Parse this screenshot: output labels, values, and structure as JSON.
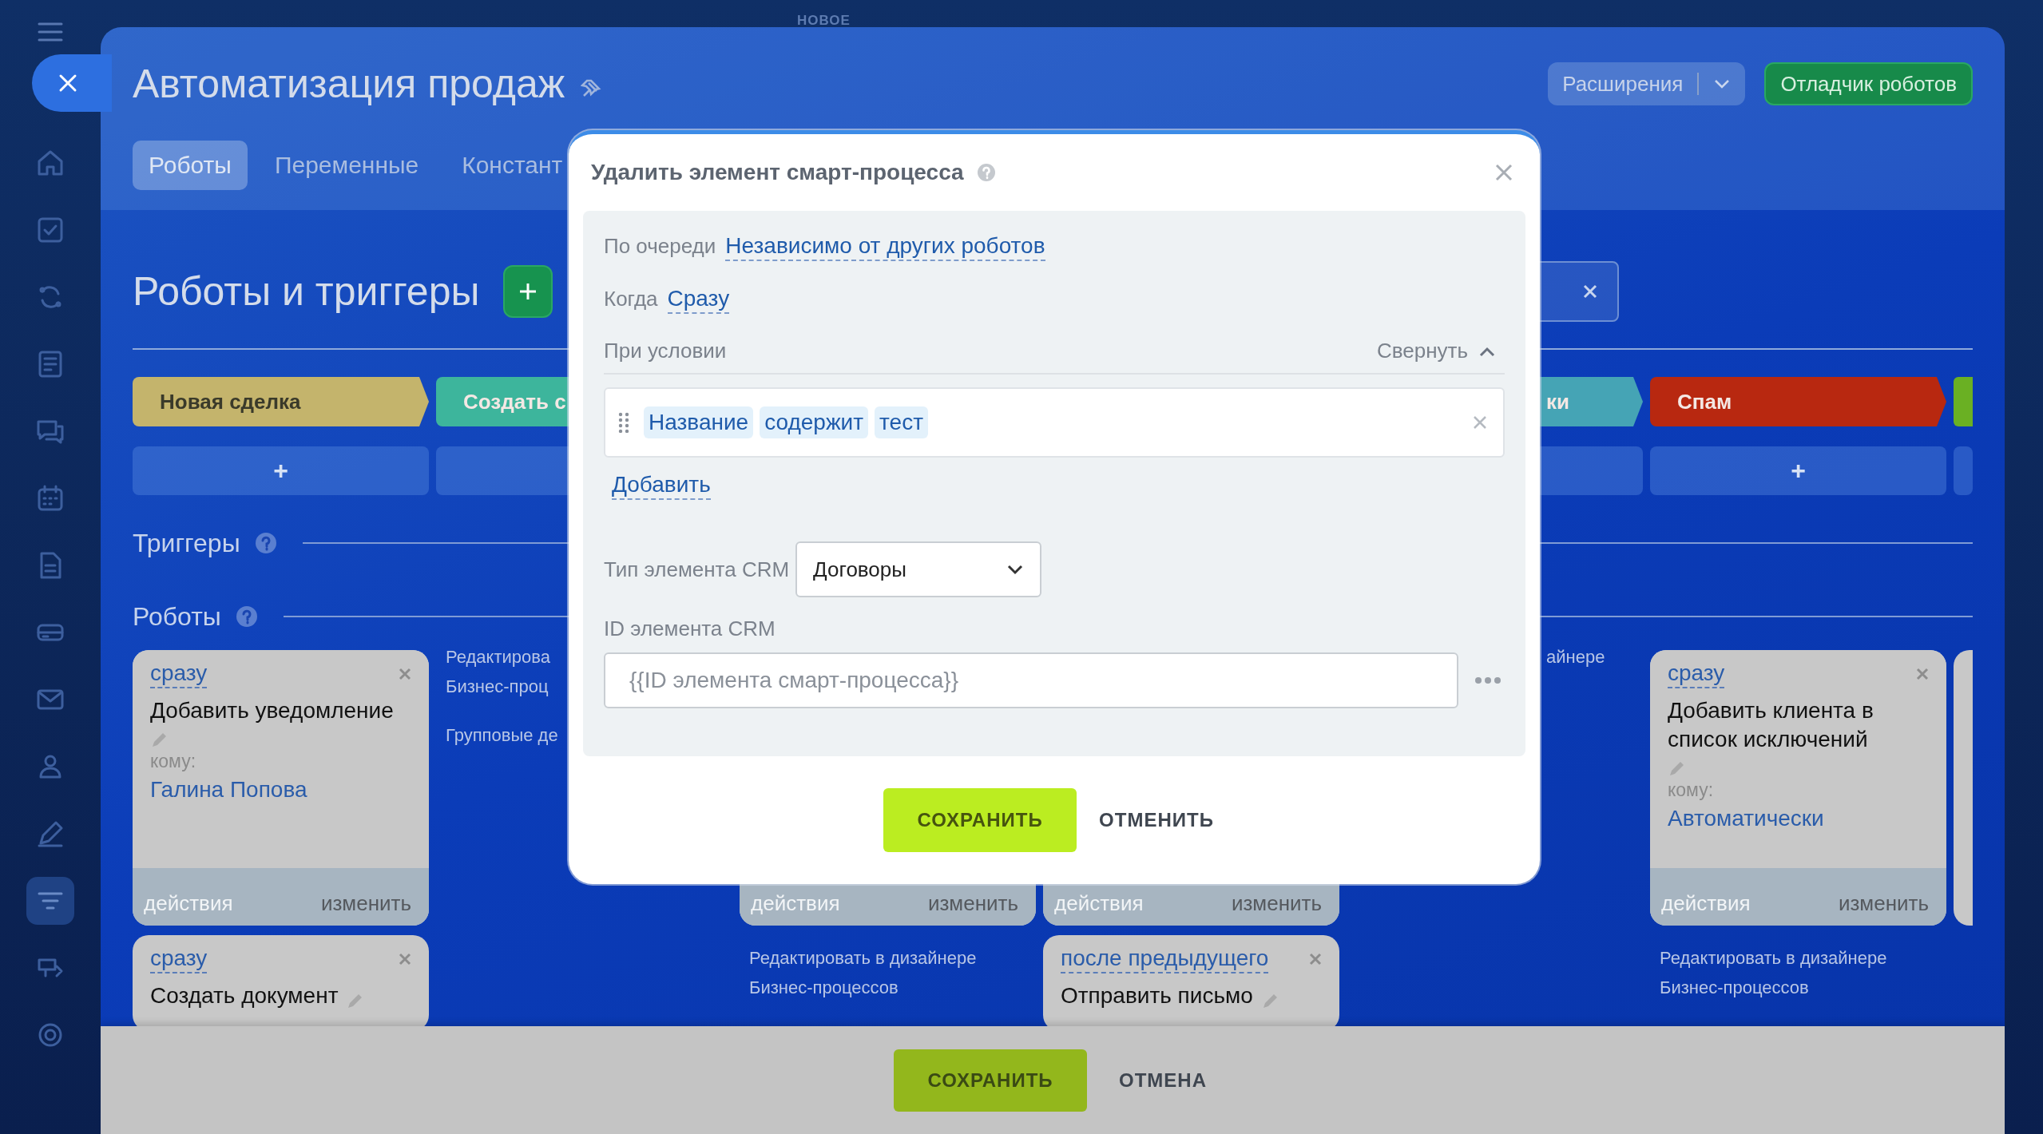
{
  "top_label": "НОВОЕ",
  "sidebar": {
    "items": [
      {
        "selected": false
      },
      {
        "selected": false
      },
      {
        "selected": false
      },
      {
        "selected": false
      },
      {
        "selected": false
      },
      {
        "selected": false
      },
      {
        "selected": false
      },
      {
        "selected": false
      },
      {
        "selected": false
      },
      {
        "selected": false
      },
      {
        "selected": false
      },
      {
        "selected": false
      },
      {
        "selected": true
      },
      {
        "selected": false
      },
      {
        "selected": false
      }
    ]
  },
  "header": {
    "title": "Автоматизация продаж",
    "buttons": [
      {
        "kind": "dropdown",
        "label": "Расширения"
      },
      {
        "kind": "primary",
        "label": "Отладчик роботов"
      }
    ]
  },
  "tabs": [
    {
      "label": "Роботы",
      "selected": true
    },
    {
      "label": "Переменные",
      "selected": false
    },
    {
      "label": "Констант",
      "selected": false
    }
  ],
  "section_title": "Роботы и триггеры",
  "triggers_heading": "Триггеры",
  "robots_heading": "Роботы",
  "columns": [
    {
      "stage": {
        "name": "Новая сделка",
        "color": "#c4b46c"
      },
      "add": "+",
      "items": [
        {
          "kind": "card",
          "delay": "сразу",
          "title": "Добавить уведомление",
          "to_label": "кому:",
          "to": "Галина Попова",
          "actions": "действия",
          "edit": "изменить"
        },
        {
          "kind": "card",
          "delay": "сразу",
          "title": "Создать документ"
        }
      ]
    },
    {
      "stage": {
        "name": "Создать с",
        "color": "#3db59c"
      },
      "items": [
        {
          "kind": "link",
          "text": "Редактирова"
        },
        {
          "kind": "link",
          "text": "Бизнес-проц"
        },
        {
          "kind": "gap"
        },
        {
          "kind": "link",
          "text": "Групповые де"
        }
      ]
    },
    {
      "items": [
        {
          "kind": "card",
          "actions": "действия",
          "edit": "изменить"
        },
        {
          "kind": "link",
          "text": "Редактировать в дизайнере"
        },
        {
          "kind": "link",
          "text": "Бизнес-процессов"
        }
      ]
    },
    {
      "items": [
        {
          "kind": "card",
          "actions": "действия",
          "edit": "изменить"
        },
        {
          "kind": "card",
          "delay": "после предыдущего",
          "title": "Отправить письмо"
        }
      ]
    },
    {
      "stage": {
        "name": "ки",
        "color": "#45a4b5"
      },
      "items": [
        {
          "kind": "link",
          "text": "айнере"
        }
      ]
    },
    {
      "stage": {
        "name": "Спам",
        "color": "#b82810"
      },
      "add": "+",
      "items": [
        {
          "kind": "card",
          "delay": "сразу",
          "title": "Добавить клиента в список исключений",
          "to_label": "кому:",
          "to": "Автоматически",
          "actions": "действия",
          "edit": "изменить"
        },
        {
          "kind": "link",
          "text": "Редактировать в дизайнере"
        },
        {
          "kind": "link",
          "text": "Бизнес-процессов"
        }
      ]
    },
    {
      "stage": {
        "color": "#6ab023"
      },
      "items": [
        {
          "kind": "card"
        }
      ]
    }
  ],
  "footer": {
    "save": "СОХРАНИТЬ",
    "cancel": "ОТМЕНА"
  },
  "dialog": {
    "title": "Удалить элемент смарт-процесса",
    "queue_label": "По очереди",
    "queue_value": "Независимо от других роботов",
    "when_label": "Когда",
    "when_value": "Сразу",
    "condition_label": "При условии",
    "collapse": "Свернуть",
    "condition": [
      "Название",
      "содержит",
      "тест"
    ],
    "add": "Добавить",
    "type_label": "Тип элемента CRM",
    "type_value": "Договоры",
    "id_label": "ID элемента CRM",
    "id_value": "{{ID элемента смарт-процесса}}",
    "save": "СОХРАНИТЬ",
    "cancel": "ОТМЕНИТЬ"
  }
}
